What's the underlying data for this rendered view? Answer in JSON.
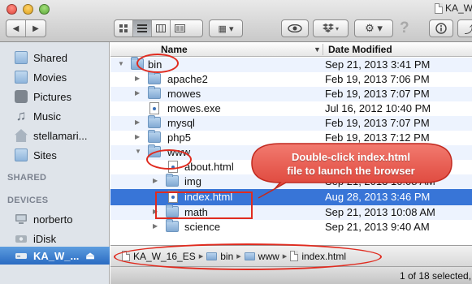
{
  "window": {
    "title": "KA_W_"
  },
  "toolbar": {
    "back_icon": "back-arrow-icon",
    "forward_icon": "forward-arrow-icon",
    "view_buttons": [
      "icon-view-icon",
      "list-view-icon",
      "column-view-icon",
      "cover-flow-icon"
    ],
    "active_view": "list-view-icon",
    "arrange_icon": "arrange-grid-icon",
    "quicklook_icon": "eye-icon",
    "dropbox_icon": "dropbox-icon",
    "action_icon": "gear-icon",
    "help_icon": "help-icon",
    "info_icon": "info-icon",
    "share_icon": "share-icon"
  },
  "sidebar": {
    "items": [
      {
        "label": "Shared",
        "icon": "folder-icon"
      },
      {
        "label": "Movies",
        "icon": "folder-icon"
      },
      {
        "label": "Pictures",
        "icon": "camera-icon"
      },
      {
        "label": "Music",
        "icon": "music-icon"
      },
      {
        "label": "stellamari...",
        "icon": "home-icon"
      },
      {
        "label": "Sites",
        "icon": "folder-icon"
      }
    ],
    "shared_header": "SHARED",
    "devices_header": "DEVICES",
    "devices": [
      {
        "label": "norberto",
        "icon": "computer-icon"
      },
      {
        "label": "iDisk",
        "icon": "idisk-icon"
      },
      {
        "label": "KA_W_...",
        "icon": "disk-icon",
        "eject": "eject-icon",
        "selected": true
      }
    ]
  },
  "columns": {
    "name": "Name",
    "date": "Date Modified",
    "sort_indicator": "▼"
  },
  "files": [
    {
      "name": "bin",
      "date": "Sep 21, 2013 3:41 PM",
      "type": "folder",
      "expanded": true
    },
    {
      "name": "apache2",
      "date": "Feb 19, 2013 7:06 PM",
      "type": "folder"
    },
    {
      "name": "mowes",
      "date": "Feb 19, 2013 7:07 PM",
      "type": "folder"
    },
    {
      "name": "mowes.exe",
      "date": "Jul 16, 2012 10:40 PM",
      "type": "file"
    },
    {
      "name": "mysql",
      "date": "Feb 19, 2013 7:07 PM",
      "type": "folder"
    },
    {
      "name": "php5",
      "date": "Feb 19, 2013 7:12 PM",
      "type": "folder"
    },
    {
      "name": "www",
      "date": "",
      "type": "folder",
      "expanded": true
    },
    {
      "name": "about.html",
      "date": "",
      "type": "html"
    },
    {
      "name": "img",
      "date": "Sep 21, 2013 10:08 AM",
      "type": "folder"
    },
    {
      "name": "index.html",
      "date": "Aug 28, 2013 3:46 PM",
      "type": "html",
      "selected": true
    },
    {
      "name": "math",
      "date": "Sep 21, 2013 10:08 AM",
      "type": "folder"
    },
    {
      "name": "science",
      "date": "Sep 21, 2013 9:40 AM",
      "type": "folder"
    }
  ],
  "path": {
    "items": [
      "KA_W_16_ES",
      "bin",
      "www",
      "index.html"
    ],
    "separator": "▸"
  },
  "status": {
    "text": "1 of 18 selected,"
  },
  "callout": {
    "line1": "Double-click index.html",
    "line2": "file to launch the browser"
  },
  "annotation_color": "#e02b1f"
}
